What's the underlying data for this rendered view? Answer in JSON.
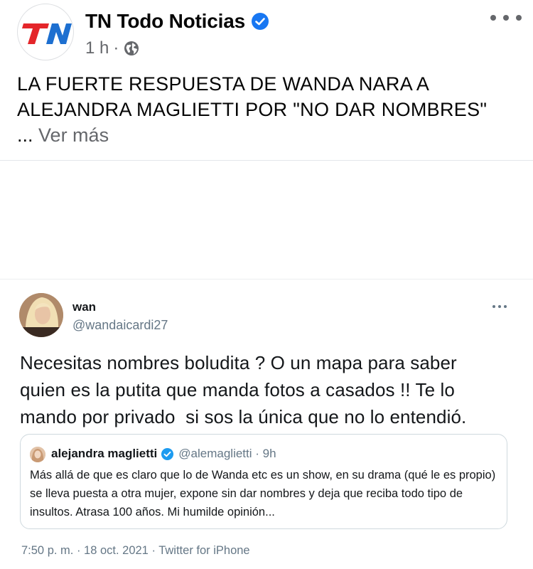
{
  "post": {
    "page_name": "TN Todo Noticias",
    "page_logo_text": "TN",
    "time": "1 h",
    "separator": "·",
    "text": "LA FUERTE RESPUESTA DE WANDA NARA A ALEJANDRA MAGLIETTI POR \"NO DAR NOMBRES\"",
    "ellipsis": "...",
    "see_more": "Ver más",
    "icons": [
      "verified-icon",
      "globe-icon",
      "more-options-icon"
    ]
  },
  "tweet": {
    "name": "wan",
    "handle": "@wandaicardi27",
    "text": "Necesitas nombres boludita ? O un mapa para saber\nquien es la putita que manda fotos a casados !! Te lo\nmando por privado  si sos la única que no lo entendió.",
    "quoted": {
      "name": "alejandra maglietti",
      "handle": "@alemaglietti · 9h",
      "text": "Más allá de que es claro que lo de Wanda etc es un show, en su drama (qué le es propio) se lleva puesta a otra mujer, expone sin dar nombres y deja que reciba todo tipo de insultos. Atrasa 100 años. Mi humilde opinión..."
    },
    "footer": "7:50 p. m. · 18 oct. 2021 · Twitter for iPhone"
  },
  "colors": {
    "brand_red": "#e4262a",
    "brand_blue": "#1877f2",
    "twitter_blue": "#1d9bf0",
    "secondary_text": "#65676b"
  }
}
